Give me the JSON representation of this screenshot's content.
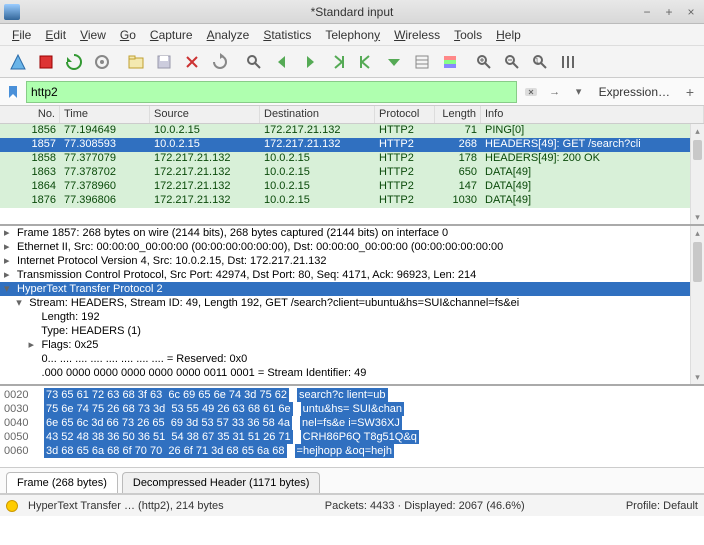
{
  "window": {
    "title": "*Standard input"
  },
  "menu": [
    "File",
    "Edit",
    "View",
    "Go",
    "Capture",
    "Analyze",
    "Statistics",
    "Telephony",
    "Wireless",
    "Tools",
    "Help"
  ],
  "filter": {
    "value": "http2",
    "expression_label": "Expression…"
  },
  "columns": {
    "no": "No.",
    "time": "Time",
    "src": "Source",
    "dst": "Destination",
    "proto": "Protocol",
    "len": "Length",
    "info": "Info"
  },
  "packets": [
    {
      "no": "1856",
      "time": "77.194649",
      "src": "10.0.2.15",
      "dst": "172.217.21.132",
      "proto": "HTTP2",
      "len": "71",
      "info": "PING[0]",
      "sel": false
    },
    {
      "no": "1857",
      "time": "77.308593",
      "src": "10.0.2.15",
      "dst": "172.217.21.132",
      "proto": "HTTP2",
      "len": "268",
      "info": "HEADERS[49]: GET /search?cli",
      "sel": true
    },
    {
      "no": "1858",
      "time": "77.377079",
      "src": "172.217.21.132",
      "dst": "10.0.2.15",
      "proto": "HTTP2",
      "len": "178",
      "info": "HEADERS[49]: 200 OK",
      "sel": false
    },
    {
      "no": "1863",
      "time": "77.378702",
      "src": "172.217.21.132",
      "dst": "10.0.2.15",
      "proto": "HTTP2",
      "len": "650",
      "info": "DATA[49]",
      "sel": false
    },
    {
      "no": "1864",
      "time": "77.378960",
      "src": "172.217.21.132",
      "dst": "10.0.2.15",
      "proto": "HTTP2",
      "len": "147",
      "info": "DATA[49]",
      "sel": false
    },
    {
      "no": "1876",
      "time": "77.396806",
      "src": "172.217.21.132",
      "dst": "10.0.2.15",
      "proto": "HTTP2",
      "len": "1030",
      "info": "DATA[49]",
      "sel": false
    }
  ],
  "details": [
    {
      "indent": 0,
      "tri": "▸",
      "text": "Frame 1857: 268 bytes on wire (2144 bits), 268 bytes captured (2144 bits) on interface 0",
      "sel": false
    },
    {
      "indent": 0,
      "tri": "▸",
      "text": "Ethernet II, Src: 00:00:00_00:00:00 (00:00:00:00:00:00), Dst: 00:00:00_00:00:00 (00:00:00:00:00:00",
      "sel": false
    },
    {
      "indent": 0,
      "tri": "▸",
      "text": "Internet Protocol Version 4, Src: 10.0.2.15, Dst: 172.217.21.132",
      "sel": false
    },
    {
      "indent": 0,
      "tri": "▸",
      "text": "Transmission Control Protocol, Src Port: 42974, Dst Port: 80, Seq: 4171, Ack: 96923, Len: 214",
      "sel": false
    },
    {
      "indent": 0,
      "tri": "▾",
      "text": "HyperText Transfer Protocol 2",
      "sel": true
    },
    {
      "indent": 1,
      "tri": "▾",
      "text": "Stream: HEADERS, Stream ID: 49, Length 192, GET /search?client=ubuntu&hs=SUI&channel=fs&ei",
      "sel": false
    },
    {
      "indent": 2,
      "tri": "",
      "text": "Length: 192",
      "sel": false
    },
    {
      "indent": 2,
      "tri": "",
      "text": "Type: HEADERS (1)",
      "sel": false
    },
    {
      "indent": 2,
      "tri": "▸",
      "text": "Flags: 0x25",
      "sel": false
    },
    {
      "indent": 2,
      "tri": "",
      "text": "0... .... .... .... .... .... .... .... = Reserved: 0x0",
      "sel": false
    },
    {
      "indent": 2,
      "tri": "",
      "text": ".000 0000 0000 0000 0000 0000 0011 0001 = Stream Identifier: 49",
      "sel": false
    }
  ],
  "hex": [
    {
      "off": "0020",
      "hex": "73 65 61 72 63 68 3f 63  6c 69 65 6e 74 3d 75 62",
      "asc": "search?c lient=ub"
    },
    {
      "off": "0030",
      "hex": "75 6e 74 75 26 68 73 3d  53 55 49 26 63 68 61 6e",
      "asc": "untu&hs= SUI&chan"
    },
    {
      "off": "0040",
      "hex": "6e 65 6c 3d 66 73 26 65  69 3d 53 57 33 36 58 4a",
      "asc": "nel=fs&e i=SW36XJ"
    },
    {
      "off": "0050",
      "hex": "43 52 48 38 36 50 36 51  54 38 67 35 31 51 26 71",
      "asc": "CRH86P6Q T8g51Q&q"
    },
    {
      "off": "0060",
      "hex": "3d 68 65 6a 68 6f 70 70  26 6f 71 3d 68 65 6a 68",
      "asc": "=hejhopp &oq=hejh"
    }
  ],
  "tabs": {
    "t1": "Frame (268 bytes)",
    "t2": "Decompressed Header (1171 bytes)"
  },
  "status": {
    "left": "HyperText Transfer … (http2), 214 bytes",
    "center": "Packets: 4433 · Displayed: 2067 (46.6%)",
    "right": "Profile: Default"
  }
}
